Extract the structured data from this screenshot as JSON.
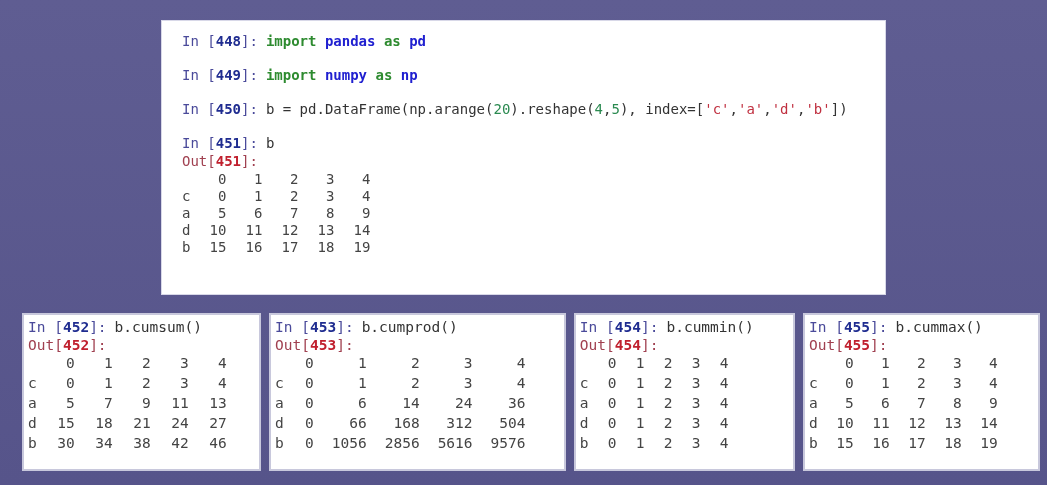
{
  "main_console": {
    "inputs": [
      {
        "prompt": "In [**448**]:",
        "code": [
          {
            "text": "import",
            "kind": "keyword"
          },
          {
            "text": " pandas",
            "kind": "name"
          },
          {
            "text": " as",
            "kind": "keyword"
          },
          {
            "text": " pd",
            "kind": "name"
          }
        ]
      },
      {
        "prompt": "In [**449**]:",
        "code": [
          {
            "text": "import",
            "kind": "keyword"
          },
          {
            "text": " numpy",
            "kind": "name"
          },
          {
            "text": " as",
            "kind": "keyword"
          },
          {
            "text": " np",
            "kind": "name"
          }
        ]
      },
      {
        "prompt": "In [**450**]:",
        "code": [
          {
            "text": "b = pd.DataFrame(np.arange(",
            "kind": "plain"
          },
          {
            "text": "20",
            "kind": "number"
          },
          {
            "text": ").reshape(",
            "kind": "plain"
          },
          {
            "text": "4",
            "kind": "number"
          },
          {
            "text": ",",
            "kind": "plain"
          },
          {
            "text": "5",
            "kind": "number"
          },
          {
            "text": "), index=[",
            "kind": "plain"
          },
          {
            "text": "'c'",
            "kind": "string"
          },
          {
            "text": ",",
            "kind": "plain"
          },
          {
            "text": "'a'",
            "kind": "string"
          },
          {
            "text": ",",
            "kind": "plain"
          },
          {
            "text": "'d'",
            "kind": "string"
          },
          {
            "text": ",",
            "kind": "plain"
          },
          {
            "text": "'b'",
            "kind": "string"
          },
          {
            "text": "])",
            "kind": "plain"
          }
        ]
      },
      {
        "prompt": "In [**451**]:",
        "code": [
          {
            "text": "b",
            "kind": "plain"
          }
        ],
        "output": {
          "prompt": "Out[**451**]:",
          "columns": [
            "0",
            "1",
            "2",
            "3",
            "4"
          ],
          "rows": [
            {
              "index": "c",
              "values": [
                "0",
                "1",
                "2",
                "3",
                "4"
              ]
            },
            {
              "index": "a",
              "values": [
                "5",
                "6",
                "7",
                "8",
                "9"
              ]
            },
            {
              "index": "d",
              "values": [
                "10",
                "11",
                "12",
                "13",
                "14"
              ]
            },
            {
              "index": "b",
              "values": [
                "15",
                "16",
                "17",
                "18",
                "19"
              ]
            }
          ]
        }
      }
    ]
  },
  "result_panels": [
    {
      "prompt": "In [**452**]:",
      "code": "b.cumsum()",
      "out_prompt": "Out[**452**]:",
      "columns": [
        "0",
        "1",
        "2",
        "3",
        "4"
      ],
      "rows": [
        {
          "index": "c",
          "values": [
            "0",
            "1",
            "2",
            "3",
            "4"
          ]
        },
        {
          "index": "a",
          "values": [
            "5",
            "7",
            "9",
            "11",
            "13"
          ]
        },
        {
          "index": "d",
          "values": [
            "15",
            "18",
            "21",
            "24",
            "27"
          ]
        },
        {
          "index": "b",
          "values": [
            "30",
            "34",
            "38",
            "42",
            "46"
          ]
        }
      ]
    },
    {
      "prompt": "In [**453**]:",
      "code": "b.cumprod()",
      "out_prompt": "Out[**453**]:",
      "columns": [
        "0",
        "1",
        "2",
        "3",
        "4"
      ],
      "rows": [
        {
          "index": "c",
          "values": [
            "0",
            "1",
            "2",
            "3",
            "4"
          ]
        },
        {
          "index": "a",
          "values": [
            "0",
            "6",
            "14",
            "24",
            "36"
          ]
        },
        {
          "index": "d",
          "values": [
            "0",
            "66",
            "168",
            "312",
            "504"
          ]
        },
        {
          "index": "b",
          "values": [
            "0",
            "1056",
            "2856",
            "5616",
            "9576"
          ]
        }
      ]
    },
    {
      "prompt": "In [**454**]:",
      "code": "b.cummin()",
      "out_prompt": "Out[**454**]:",
      "columns": [
        "0",
        "1",
        "2",
        "3",
        "4"
      ],
      "rows": [
        {
          "index": "c",
          "values": [
            "0",
            "1",
            "2",
            "3",
            "4"
          ]
        },
        {
          "index": "a",
          "values": [
            "0",
            "1",
            "2",
            "3",
            "4"
          ]
        },
        {
          "index": "d",
          "values": [
            "0",
            "1",
            "2",
            "3",
            "4"
          ]
        },
        {
          "index": "b",
          "values": [
            "0",
            "1",
            "2",
            "3",
            "4"
          ]
        }
      ]
    },
    {
      "prompt": "In [**455**]:",
      "code": "b.cummax()",
      "out_prompt": "Out[**455**]:",
      "columns": [
        "0",
        "1",
        "2",
        "3",
        "4"
      ],
      "rows": [
        {
          "index": "c",
          "values": [
            "0",
            "1",
            "2",
            "3",
            "4"
          ]
        },
        {
          "index": "a",
          "values": [
            "5",
            "6",
            "7",
            "8",
            "9"
          ]
        },
        {
          "index": "d",
          "values": [
            "10",
            "11",
            "12",
            "13",
            "14"
          ]
        },
        {
          "index": "b",
          "values": [
            "15",
            "16",
            "17",
            "18",
            "19"
          ]
        }
      ]
    }
  ]
}
